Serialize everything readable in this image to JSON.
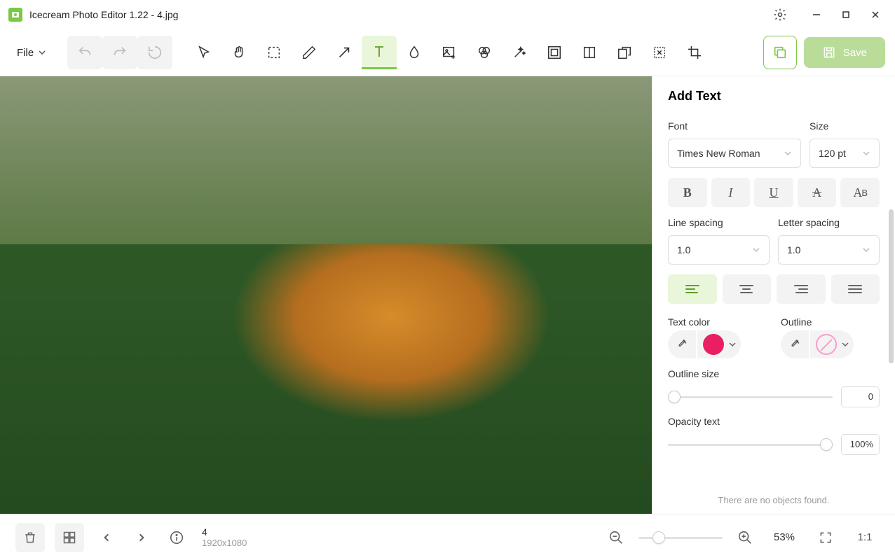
{
  "title": "Icecream Photo Editor 1.22 - 4.jpg",
  "file_menu": "File",
  "save_label": "Save",
  "panel": {
    "title": "Add Text",
    "font_label": "Font",
    "font_value": "Times New Roman",
    "size_label": "Size",
    "size_value": "120 pt",
    "line_spacing_label": "Line spacing",
    "line_spacing_value": "1.0",
    "letter_spacing_label": "Letter spacing",
    "letter_spacing_value": "1.0",
    "text_color_label": "Text color",
    "text_color_hex": "#e91e63",
    "outline_label": "Outline",
    "outline_size_label": "Outline size",
    "outline_size_value": "0",
    "opacity_label": "Opacity text",
    "opacity_value": "100%"
  },
  "bottom": {
    "image_index": "4",
    "dimensions": "1920x1080",
    "zoom": "53%",
    "ratio": "1:1"
  },
  "objects_msg": "There are no objects found."
}
